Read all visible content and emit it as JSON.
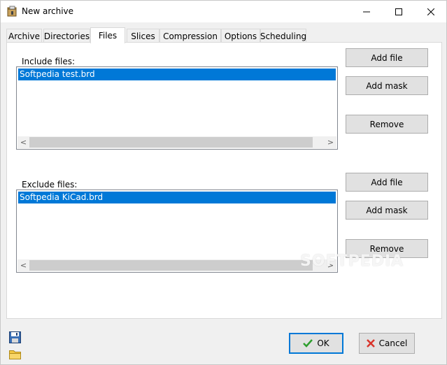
{
  "window": {
    "title": "New archive",
    "controls": {
      "minimize": "minimize-icon",
      "maximize": "maximize-icon",
      "close": "close-icon"
    }
  },
  "tabs": [
    {
      "label": "Archive"
    },
    {
      "label": "Directories"
    },
    {
      "label": "Files",
      "active": true
    },
    {
      "label": "Slices"
    },
    {
      "label": "Compression"
    },
    {
      "label": "Options"
    },
    {
      "label": "Scheduling"
    }
  ],
  "include": {
    "label": "Include files:",
    "items": [
      "Softpedia test.brd"
    ],
    "buttons": {
      "add_file": "Add file",
      "add_mask": "Add mask",
      "remove": "Remove"
    }
  },
  "exclude": {
    "label": "Exclude files:",
    "items": [
      "Softpedia KiCad.brd"
    ],
    "buttons": {
      "add_file": "Add file",
      "add_mask": "Add mask",
      "remove": "Remove"
    }
  },
  "footer": {
    "ok": "OK",
    "cancel": "Cancel",
    "icons": [
      "save-icon",
      "folder-icon"
    ]
  },
  "watermark": "SOFTPEDIA",
  "colors": {
    "selection": "#0078d7",
    "ok_border": "#0078d7",
    "ok_check": "#2e9e2e",
    "cancel_x": "#d9342b"
  }
}
